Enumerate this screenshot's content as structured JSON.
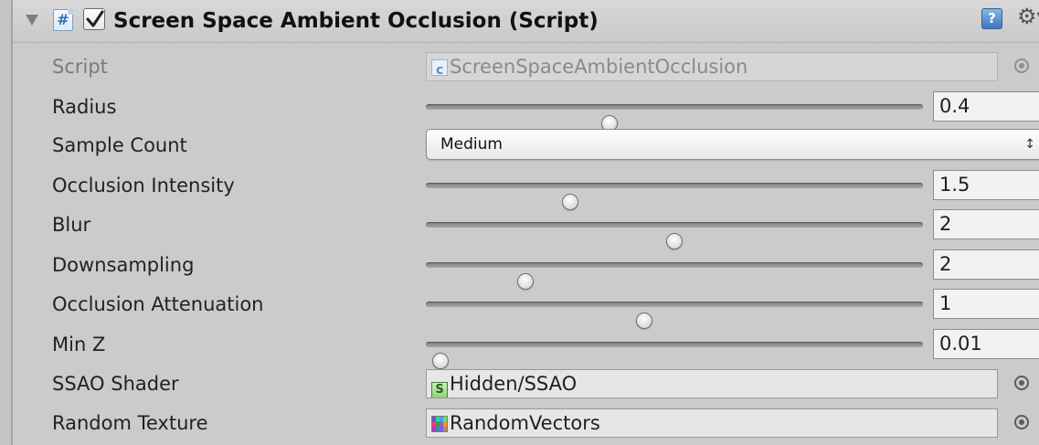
{
  "component": {
    "title": "Screen Space Ambient Occlusion (Script)",
    "enabled": true,
    "script_icon": "csharp-script-icon",
    "help_icon": "help-icon",
    "settings_icon": "gear-icon"
  },
  "fields": {
    "script": {
      "label": "Script",
      "value": "ScreenSpaceAmbientOcclusion",
      "icon": "csharp-script-icon"
    },
    "radius": {
      "label": "Radius",
      "value": "0.4",
      "slider_fraction": 0.37
    },
    "sample_count": {
      "label": "Sample Count",
      "value": "Medium",
      "arrows": "↕"
    },
    "occlusion_intensity": {
      "label": "Occlusion Intensity",
      "value": "1.5",
      "slider_fraction": 0.29
    },
    "blur": {
      "label": "Blur",
      "value": "2",
      "slider_fraction": 0.5
    },
    "downsampling": {
      "label": "Downsampling",
      "value": "2",
      "slider_fraction": 0.2
    },
    "occlusion_attenuation": {
      "label": "Occlusion Attenuation",
      "value": "1",
      "slider_fraction": 0.44
    },
    "min_z": {
      "label": "Min Z",
      "value": "0.01",
      "slider_fraction": 0.03
    },
    "ssao_shader": {
      "label": "SSAO Shader",
      "value": "Hidden/SSAO",
      "icon": "shader-icon",
      "icon_glyph": "S"
    },
    "random_texture": {
      "label": "Random Texture",
      "value": "RandomVectors",
      "icon": "texture-icon"
    }
  }
}
